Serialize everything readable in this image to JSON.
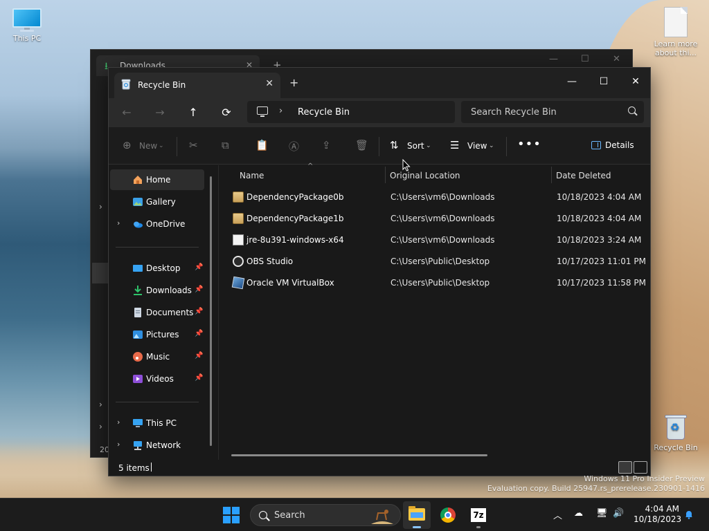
{
  "desktop": {
    "this_pc": "This PC",
    "learn_more": "Learn more about thi...",
    "recycle_bin": "Recycle Bin"
  },
  "bg_window": {
    "tab_title": "Downloads",
    "year_fragment": "20"
  },
  "window": {
    "tab_title": "Recycle Bin",
    "close_tab": "✕",
    "new_tab": "+",
    "minimize": "—",
    "maximize": "☐",
    "close": "✕"
  },
  "nav": {
    "back": "←",
    "forward": "→",
    "up": "↑",
    "refresh": "⟳",
    "breadcrumb_chevron": "›",
    "location": "Recycle Bin",
    "search_placeholder": "Search Recycle Bin"
  },
  "toolbar": {
    "new_label": "New",
    "sort_label": "Sort",
    "view_label": "View",
    "more": "•••",
    "details_label": "Details"
  },
  "sidebar": {
    "items": [
      {
        "label": "Home",
        "icon": "home-icon",
        "selected": true
      },
      {
        "label": "Gallery",
        "icon": "gallery-icon"
      },
      {
        "label": "OneDrive",
        "icon": "onedrive-icon",
        "expandable": true
      },
      {
        "label": "Desktop",
        "icon": "desktop-icon",
        "pinned": true
      },
      {
        "label": "Downloads",
        "icon": "downloads-icon",
        "pinned": true
      },
      {
        "label": "Documents",
        "icon": "documents-icon",
        "pinned": true
      },
      {
        "label": "Pictures",
        "icon": "pictures-icon",
        "pinned": true
      },
      {
        "label": "Music",
        "icon": "music-icon",
        "pinned": true
      },
      {
        "label": "Videos",
        "icon": "videos-icon",
        "pinned": true
      },
      {
        "label": "This PC",
        "icon": "this-pc-icon",
        "expandable": true
      },
      {
        "label": "Network",
        "icon": "network-icon",
        "expandable": true
      }
    ]
  },
  "columns": {
    "name": "Name",
    "original_location": "Original Location",
    "date_deleted": "Date Deleted"
  },
  "files": [
    {
      "name": "DependencyPackage0b",
      "location": "C:\\Users\\vm6\\Downloads",
      "date": "10/18/2023 4:04 AM",
      "icon": "zip-icon"
    },
    {
      "name": "DependencyPackage1b",
      "location": "C:\\Users\\vm6\\Downloads",
      "date": "10/18/2023 4:04 AM",
      "icon": "zip-icon"
    },
    {
      "name": "jre-8u391-windows-x64",
      "location": "C:\\Users\\vm6\\Downloads",
      "date": "10/18/2023 3:24 AM",
      "icon": "java-icon"
    },
    {
      "name": "OBS Studio",
      "location": "C:\\Users\\Public\\Desktop",
      "date": "10/17/2023 11:01 PM",
      "icon": "obs-icon"
    },
    {
      "name": "Oracle VM VirtualBox",
      "location": "C:\\Users\\Public\\Desktop",
      "date": "10/17/2023 11:58 PM",
      "icon": "virtualbox-icon"
    }
  ],
  "status": {
    "item_count": "5 items"
  },
  "watermark": {
    "line1": "Windows 11 Pro Insider Preview",
    "line2": "Evaluation copy. Build 25947.rs_prerelease.230901-1416"
  },
  "taskbar": {
    "search_label": "Search",
    "time": "4:04 AM",
    "date": "10/18/2023",
    "zip_label": "7z"
  },
  "colors": {
    "accent": "#2aa0ff",
    "window_bg": "#191919",
    "navbar_bg": "#2b2b2b"
  }
}
